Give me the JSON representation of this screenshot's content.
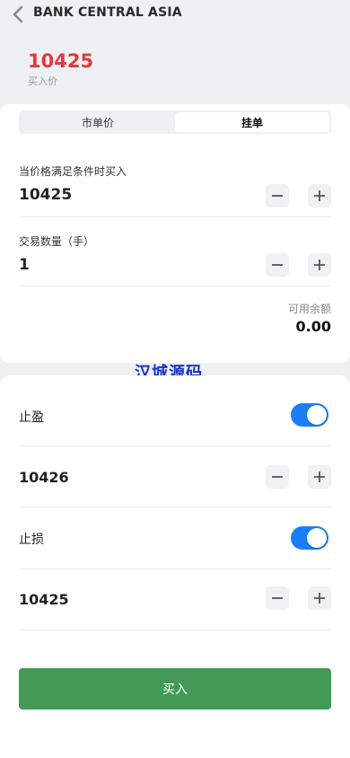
{
  "header": {
    "title": "BANK CENTRAL ASIA",
    "back_icon": "chevron-left-icon"
  },
  "price": {
    "value": "10425",
    "label": "买入价",
    "color": "#e3383f"
  },
  "order_tabs": [
    {
      "label": "市单价",
      "active": false
    },
    {
      "label": "挂单",
      "active": true
    }
  ],
  "trigger": {
    "label": "当价格满足条件时买入",
    "value": "10425"
  },
  "quantity": {
    "label": "交易数量（手）",
    "value": "1"
  },
  "balance": {
    "label": "可用余额",
    "value": "0.00"
  },
  "watermark": "汉城源码",
  "take_profit": {
    "label": "止盈",
    "enabled": true,
    "value": "10426"
  },
  "stop_loss": {
    "label": "止损",
    "enabled": true,
    "value": "10425"
  },
  "buy_button": {
    "label": "买入",
    "color": "#439a55"
  },
  "icons": {
    "minus": "minus-icon",
    "plus": "plus-icon"
  },
  "colors": {
    "toggle_on": "#1b7ef6",
    "background": "#eff0f4"
  }
}
